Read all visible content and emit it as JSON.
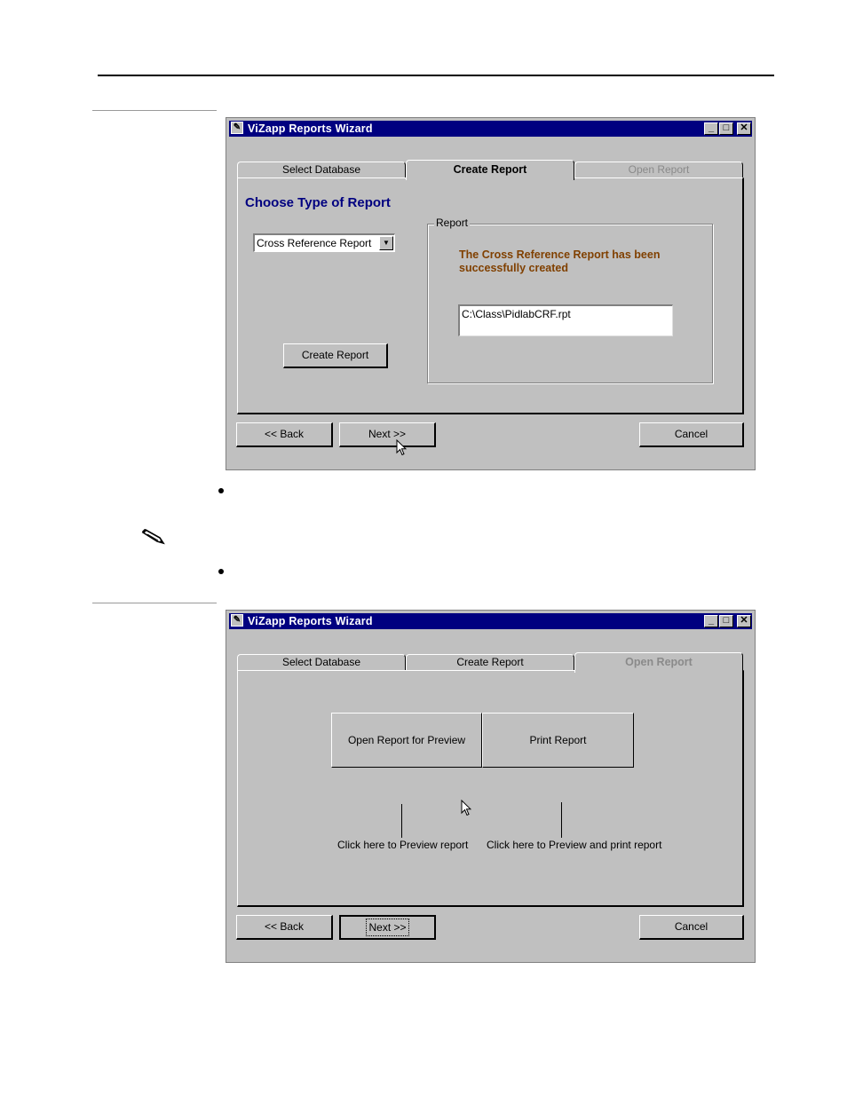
{
  "window_title": "ViZapp Reports Wizard",
  "tabs": {
    "select_database": "Select Database",
    "create_report": "Create Report",
    "open_report": "Open Report"
  },
  "screen1": {
    "heading": "Choose Type of Report",
    "report_type_selected": "Cross Reference Report",
    "create_button": "Create Report",
    "group_label": "Report",
    "success_message": "The Cross Reference Report has been successfully created",
    "file_path": "C:\\Class\\PidlabCRF.rpt"
  },
  "screen2": {
    "preview_button": "Open Report for Preview",
    "print_button": "Print Report",
    "preview_callout": "Click here to Preview report",
    "print_callout": "Click here to Preview and print report"
  },
  "nav": {
    "back": "<< Back",
    "next": "Next >>",
    "cancel": "Cancel"
  },
  "icons": [
    "wizard-wand-icon",
    "minimize-icon",
    "maximize-icon",
    "close-icon",
    "dropdown-arrow-icon",
    "mouse-cursor-icon",
    "pencil-note-icon",
    "bullet-icon"
  ]
}
